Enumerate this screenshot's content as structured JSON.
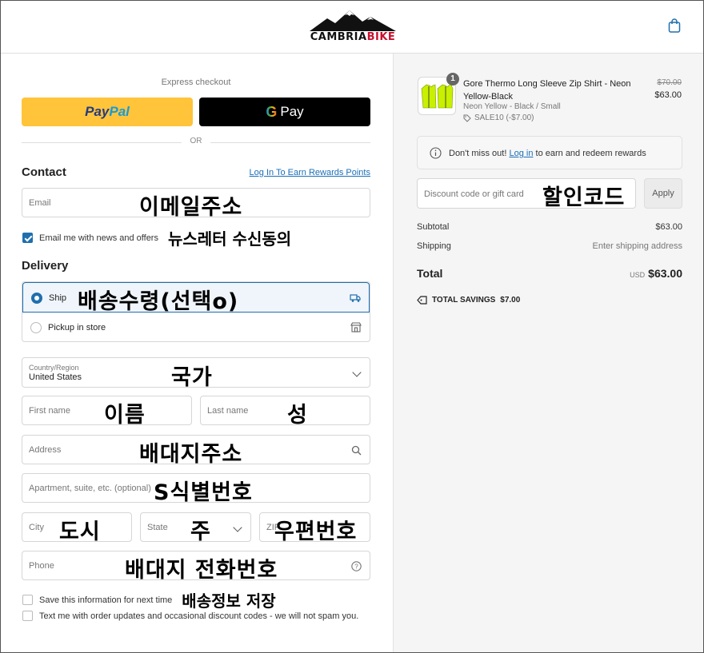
{
  "header": {
    "brand_part1": "CAMBRIA",
    "brand_part2": "BIKE",
    "cart_icon": "shopping-bag-icon",
    "brand_red": "#c8102e"
  },
  "express": {
    "label": "Express checkout",
    "paypal_part1": "Pay",
    "paypal_part2": "Pal",
    "gpay_g": "G",
    "gpay_label": "Pay",
    "or": "OR"
  },
  "contact": {
    "title": "Contact",
    "login_link": "Log In To Earn Rewards Points",
    "email_placeholder": "Email",
    "email_annotation": "이메일주소",
    "newsletter_label": "Email me with news and offers",
    "newsletter_checked": true,
    "newsletter_annotation": "뉴스레터 수신동의"
  },
  "delivery": {
    "title": "Delivery",
    "ship_label": "Ship",
    "ship_annotation": "배송수령(선택o)",
    "ship_selected": true,
    "pickup_label": "Pickup in store",
    "country_label": "Country/Region",
    "country_value": "United States",
    "country_annotation": "국가",
    "first_name_placeholder": "First name",
    "first_name_annotation": "이름",
    "last_name_placeholder": "Last name",
    "last_name_annotation": "성",
    "address_placeholder": "Address",
    "address_annotation": "배대지주소",
    "apartment_placeholder": "Apartment, suite, etc. (optional)",
    "apartment_annotation": "S식별번호",
    "city_placeholder": "City",
    "city_annotation": "도시",
    "state_placeholder": "State",
    "state_annotation": "주",
    "zip_placeholder": "ZIP",
    "zip_annotation": "우편번호",
    "phone_placeholder": "Phone",
    "phone_annotation": "배대지 전화번호",
    "save_info_label": "Save this information for next time",
    "save_info_annotation": "배송정보 저장",
    "sms_label": "Text me with order updates and occasional discount codes - we will not spam you."
  },
  "order": {
    "quantity": "1",
    "product_name": "Gore Thermo Long Sleeve Zip Shirt - Neon Yellow-Black",
    "variant": "Neon Yellow - Black / Small",
    "discount_code": "SALE10 (-$7.00)",
    "price_original": "$70.00",
    "price_current": "$63.00",
    "rewards_prefix": "Don't miss out!",
    "rewards_link": "Log in",
    "rewards_suffix": "to earn and redeem rewards",
    "discount_placeholder": "Discount code or gift card",
    "discount_annotation": "할인코드",
    "apply_label": "Apply",
    "subtotal_label": "Subtotal",
    "subtotal_value": "$63.00",
    "shipping_label": "Shipping",
    "shipping_value": "Enter shipping address",
    "total_label": "Total",
    "total_currency": "USD",
    "total_value": "$63.00",
    "savings_label": "TOTAL SAVINGS",
    "savings_value": "$7.00"
  }
}
